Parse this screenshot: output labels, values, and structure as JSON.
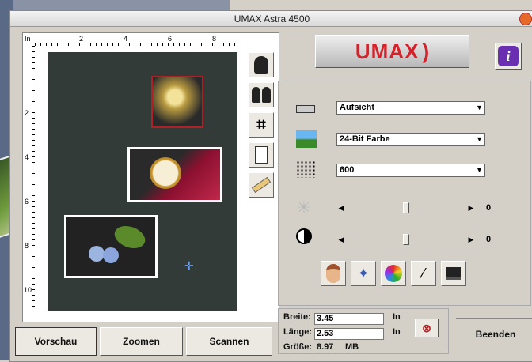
{
  "window": {
    "title": "UMAX Astra 4500"
  },
  "logo": {
    "text": "UMAX"
  },
  "ruler": {
    "unit": "In",
    "top_labels": [
      "2",
      "4",
      "6",
      "8"
    ],
    "left_labels": [
      "2",
      "4",
      "6",
      "8",
      "10"
    ]
  },
  "settings": {
    "mode": "Aufsicht",
    "color": "24-Bit Farbe",
    "resolution": "600",
    "brightness_value": "0",
    "contrast_value": "0",
    "brightness_level": 0.5,
    "contrast_level": 0.5
  },
  "size": {
    "width_label": "Breite:",
    "width_value": "3.45",
    "length_label": "Länge:",
    "length_value": "2.53",
    "unit": "In",
    "filesize_label": "Größe:",
    "filesize_value": "8.97",
    "filesize_unit": "MB"
  },
  "buttons": {
    "preview": "Vorschau",
    "zoom": "Zoomen",
    "scan": "Scannen",
    "quit": "Beenden"
  },
  "colors": {
    "accent": "#d6202a",
    "help": "#6a2fb0",
    "canvas": "#333b38"
  }
}
